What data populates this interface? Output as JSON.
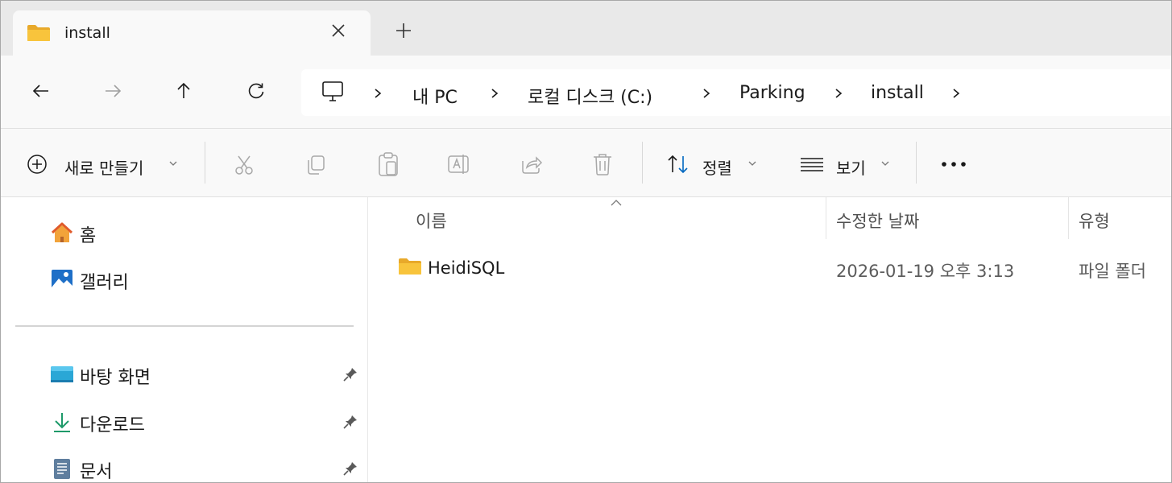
{
  "tab": {
    "title": "install"
  },
  "address": {
    "segments": [
      "내 PC",
      "로컬 디스크 (C:)",
      "Parking",
      "install"
    ]
  },
  "toolbar": {
    "new_label": "새로 만들기",
    "sort_label": "정렬",
    "view_label": "보기"
  },
  "sidebar": {
    "items": [
      {
        "label": "홈",
        "icon": "home-icon"
      },
      {
        "label": "갤러리",
        "icon": "gallery-icon"
      },
      {
        "label": "바탕 화면",
        "icon": "desktop-icon",
        "pinned": true
      },
      {
        "label": "다운로드",
        "icon": "download-icon",
        "pinned": true
      },
      {
        "label": "문서",
        "icon": "document-icon",
        "pinned": true
      }
    ]
  },
  "columns": {
    "name": "이름",
    "modified": "수정한 날짜",
    "type": "유형"
  },
  "files": [
    {
      "name": "HeidiSQL",
      "modified": "2026-01-19 오후 3:13",
      "type": "파일 폴더",
      "icon": "folder-icon"
    }
  ],
  "colors": {
    "accent": "#0067c0",
    "folder": "#f8c43c",
    "pin": "#5a5a5a"
  }
}
